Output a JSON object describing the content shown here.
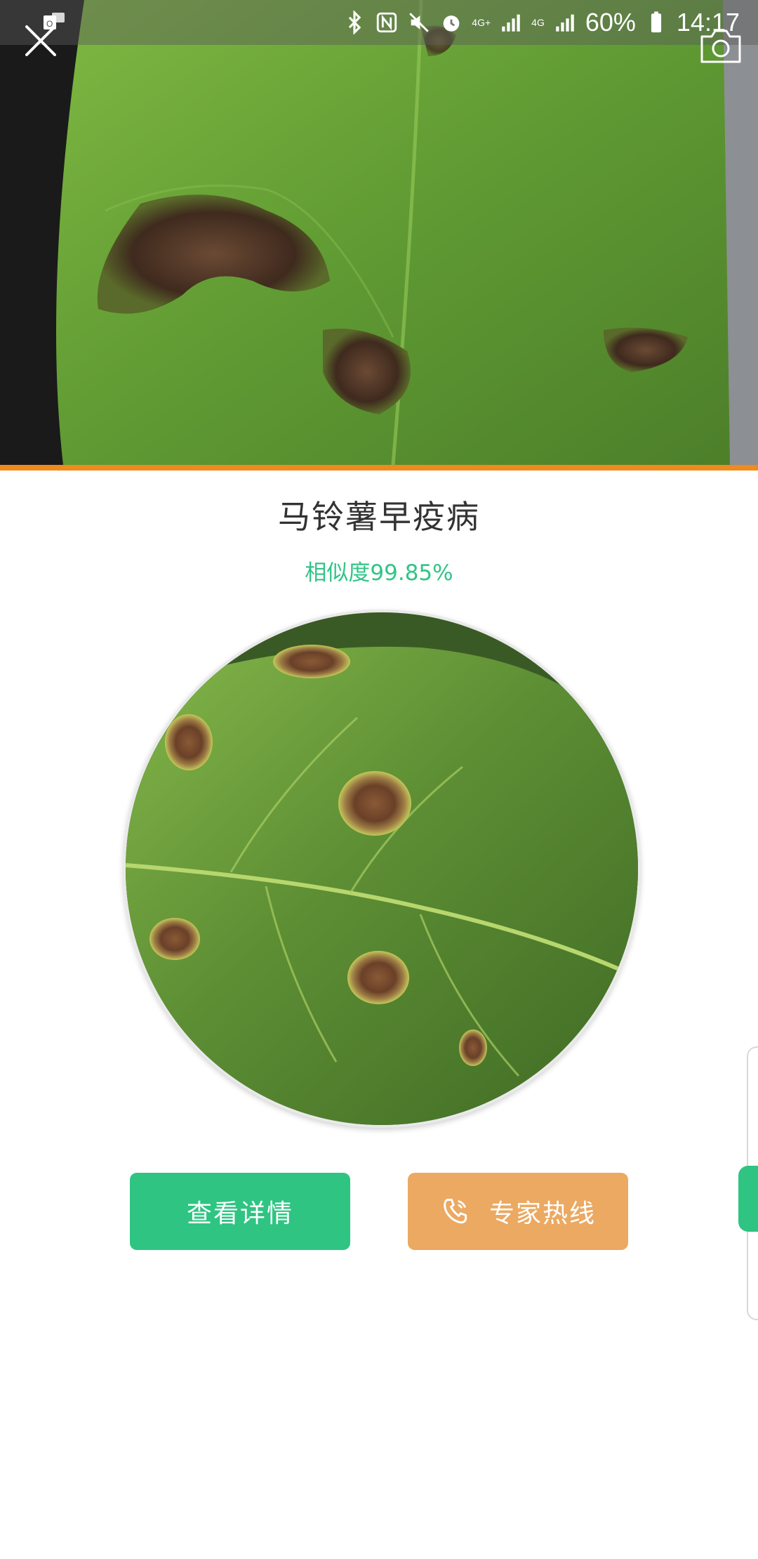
{
  "status_bar": {
    "network_1": "4G+",
    "network_2": "4G",
    "battery": "60%",
    "time": "14:17"
  },
  "hero": {
    "close_icon": "close-icon",
    "camera_icon": "camera-icon"
  },
  "result": {
    "title": "马铃薯早疫病",
    "similarity": "相似度99.85%"
  },
  "buttons": {
    "details_label": "查看详情",
    "hotline_label": "专家热线",
    "hotline_icon": "phone-icon"
  },
  "colors": {
    "accent_green": "#2fc482",
    "accent_orange": "#eba962",
    "divider_orange": "#f08a1d",
    "similarity_text": "#31c487"
  }
}
